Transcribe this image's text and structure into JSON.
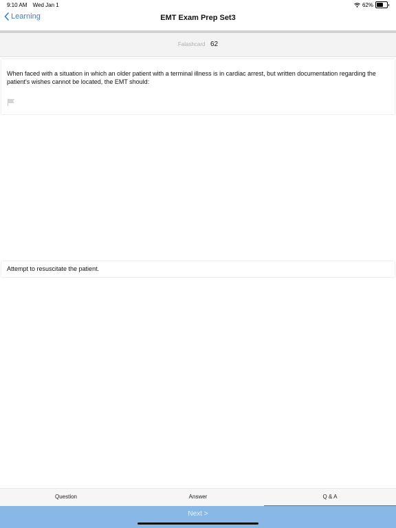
{
  "status_bar": {
    "time": "9:10 AM",
    "date": "Wed Jan 1",
    "battery_percent": "62%",
    "battery_level": 0.62,
    "wifi_icon": "wifi-icon",
    "battery_icon": "battery-icon"
  },
  "nav": {
    "back_label": "Learning",
    "title": "EMT Exam Prep Set3",
    "back_icon": "chevron-left-icon"
  },
  "flashcard": {
    "label": "Falashcard",
    "number": "62"
  },
  "question": {
    "text": "When faced with a situation in which an older patient with a terminal illness is in cardiac arrest, but written documentation regarding the patient's wishes cannot be located, the EMT should:",
    "flag_icon": "flag-icon"
  },
  "answer": {
    "text": "Attempt to resuscitate the patient."
  },
  "tabs": [
    {
      "label": "Question",
      "active": false
    },
    {
      "label": "Answer",
      "active": false
    },
    {
      "label": "Q & A",
      "active": true
    }
  ],
  "next": {
    "label": "Next >"
  },
  "colors": {
    "accent": "#2f7fd6",
    "next_bar": "#8ab8e6"
  }
}
